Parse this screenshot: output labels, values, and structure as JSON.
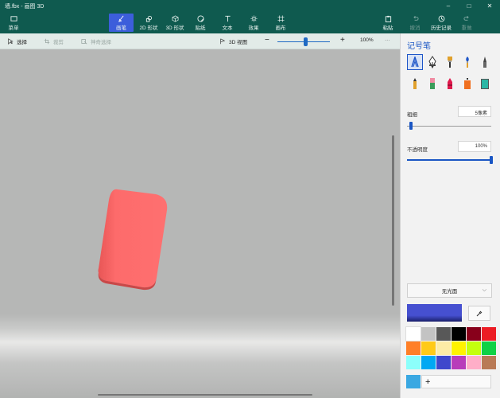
{
  "window": {
    "title": "墙.fbx - 画图 3D",
    "controls": [
      "–",
      "□",
      "✕"
    ]
  },
  "ribbon": {
    "menu": "菜单",
    "tabs": [
      {
        "label": "画笔",
        "icon": "brush-icon",
        "active": true
      },
      {
        "label": "2D 形状",
        "icon": "2d-shapes-icon"
      },
      {
        "label": "3D 形状",
        "icon": "3d-shapes-icon"
      },
      {
        "label": "贴纸",
        "icon": "sticker-icon"
      },
      {
        "label": "文本",
        "icon": "text-icon"
      },
      {
        "label": "效果",
        "icon": "effects-icon"
      },
      {
        "label": "画布",
        "icon": "canvas-icon"
      }
    ],
    "right": [
      {
        "label": "粘贴",
        "icon": "paste-icon",
        "enabled": true
      },
      {
        "label": "撤消",
        "icon": "undo-icon",
        "enabled": false
      },
      {
        "label": "历史记录",
        "icon": "history-icon",
        "enabled": true
      },
      {
        "label": "重做",
        "icon": "redo-icon",
        "enabled": false
      }
    ]
  },
  "toolbar": {
    "select": "选择",
    "crop": "裁剪",
    "magic_select": "神奇选择",
    "view3d": "3D 视图",
    "zoom_out": "−",
    "zoom_in": "+",
    "zoom": "100%",
    "more": "···"
  },
  "panel": {
    "title": "记号笔",
    "thickness_label": "粗细",
    "thickness_value": "5像素",
    "thickness_level": 0.05,
    "opacity_label": "不透明度",
    "opacity_value": "100%",
    "opacity_level": 1.0,
    "finish": "无光面",
    "current_color": "#4650d0",
    "palette": [
      "#ffffff",
      "#c3c3c3",
      "#585858",
      "#000000",
      "#88001b",
      "#ec1c24",
      "#ff7f27",
      "#ffca18",
      "#fdeca6",
      "#fff200",
      "#c4ff0e",
      "#0ed145",
      "#8cfffb",
      "#00a8f3",
      "#3f48cc",
      "#b83dba",
      "#ffaec8",
      "#b97a56"
    ],
    "custom_color": "#3aa8e2",
    "add_color": "+"
  },
  "shape": {
    "color": "#fd6b6b"
  }
}
